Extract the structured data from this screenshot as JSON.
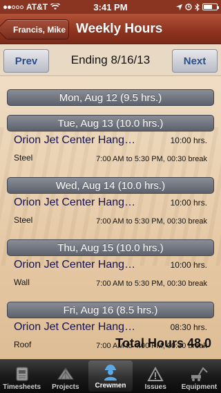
{
  "status": {
    "carrier": "AT&T",
    "time": "3:41 PM"
  },
  "nav": {
    "back_label": "Francis, Mike",
    "title": "Weekly Hours"
  },
  "week": {
    "prev_label": "Prev",
    "next_label": "Next",
    "ending_label": "Ending 8/16/13"
  },
  "days": [
    {
      "header": "Mon, Aug 12  (9.5 hrs.)",
      "entries": []
    },
    {
      "header": "Tue, Aug 13  (10.0 hrs.)",
      "entries": [
        {
          "project": "Orion Jet Center Hang…",
          "hours": "10:00 hrs.",
          "task": "Steel",
          "times": "7:00 AM to 5:30 PM, 00:30 break"
        }
      ]
    },
    {
      "header": "Wed, Aug 14  (10.0 hrs.)",
      "entries": [
        {
          "project": "Orion Jet Center Hang…",
          "hours": "10:00 hrs.",
          "task": "Steel",
          "times": "7:00 AM to 5:30 PM, 00:30 break"
        }
      ]
    },
    {
      "header": "Thu, Aug 15  (10.0 hrs.)",
      "entries": [
        {
          "project": "Orion Jet Center Hang…",
          "hours": "10:00 hrs.",
          "task": "Wall",
          "times": "7:00 AM to 5:30 PM, 00:30 break"
        }
      ]
    },
    {
      "header": "Fri, Aug 16  (8.5 hrs.)",
      "entries": [
        {
          "project": "Orion Jet Center Hang…",
          "hours": "08:30 hrs.",
          "task": "Roof",
          "times": "7:00 AM to 4:00 PM, 00:30 break"
        }
      ]
    }
  ],
  "total_label": "Total Hours 48.0",
  "tabs": [
    {
      "label": "Timesheets",
      "icon": "timesheets-icon",
      "active": false
    },
    {
      "label": "Projects",
      "icon": "projects-icon",
      "active": false
    },
    {
      "label": "Crewmen",
      "icon": "crewmen-icon",
      "active": true
    },
    {
      "label": "Issues",
      "icon": "issues-icon",
      "active": false
    },
    {
      "label": "Equipment",
      "icon": "equipment-icon",
      "active": false
    }
  ],
  "colors": {
    "navbar": "#8e331f",
    "day_header": "#5d616c",
    "project_text": "#15124f",
    "button_text": "#2a4f86"
  }
}
